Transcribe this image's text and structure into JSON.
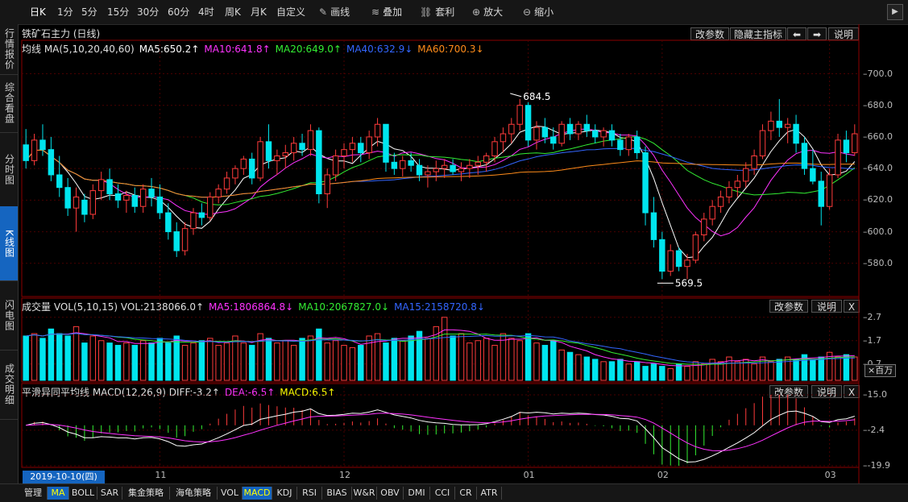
{
  "toolbar": {
    "periods": [
      "日K",
      "1分",
      "5分",
      "15分",
      "30分",
      "60分",
      "4时",
      "周K",
      "月K",
      "自定义"
    ],
    "active_period": "日K",
    "tools": [
      {
        "label": "画线",
        "icon": "pencil-icon"
      },
      {
        "label": "叠加",
        "icon": "stack-icon"
      },
      {
        "label": "套利",
        "icon": "link-icon"
      },
      {
        "label": "放大",
        "icon": "zoom-in-icon"
      },
      {
        "label": "缩小",
        "icon": "zoom-out-icon"
      }
    ]
  },
  "sidebar": {
    "tabs": [
      "行情报价",
      "综合看盘",
      "分时图",
      "K线图",
      "闪电图",
      "成交明细"
    ],
    "active": "K线图"
  },
  "main_chart": {
    "title": "铁矿石主力 (日线)",
    "buttons": {
      "params": "改参数",
      "hide": "隐藏主指标",
      "prev": "⬅",
      "next": "➡",
      "help": "说明"
    },
    "ma_legend": [
      {
        "text": "均线 MA(5,10,20,40,60)",
        "color": "#e0e0e0"
      },
      {
        "text": "MA5:650.2↑",
        "color": "#ffffff"
      },
      {
        "text": "MA10:641.8↑",
        "color": "#ff33ff"
      },
      {
        "text": "MA20:649.0↑",
        "color": "#33ee33"
      },
      {
        "text": "MA40:632.9↓",
        "color": "#3366ff"
      },
      {
        "text": "MA60:700.3↓",
        "color": "#ff8c1a"
      }
    ],
    "y_ticks": [
      "700.0",
      "680.0",
      "660.0",
      "640.0",
      "620.0",
      "600.0",
      "580.0"
    ],
    "annotations": {
      "high": "684.5",
      "low": "569.5"
    }
  },
  "vol_chart": {
    "legend": [
      {
        "text": "成交量 VOL(5,10,15) VOL:2138066.0↑",
        "color": "#e0e0e0"
      },
      {
        "text": "MA5:1806864.8↓",
        "color": "#ff33ff"
      },
      {
        "text": "MA10:2067827.0↓",
        "color": "#33ee33"
      },
      {
        "text": "MA15:2158720.8↓",
        "color": "#3366ff"
      }
    ],
    "buttons": {
      "params": "改参数",
      "help": "说明",
      "close": "X"
    },
    "y_ticks": [
      "2.7",
      "1.7",
      "0.7"
    ],
    "unit": "×百万"
  },
  "macd_chart": {
    "legend": [
      {
        "text": "平滑异同平均线 MACD(12,26,9) DIFF:-3.2↑",
        "color": "#e0e0e0"
      },
      {
        "text": "DEA:-6.5↑",
        "color": "#ff33ff"
      },
      {
        "text": "MACD:6.5↑",
        "color": "#ffff00"
      }
    ],
    "buttons": {
      "params": "改参数",
      "help": "说明",
      "close": "X"
    },
    "y_ticks": [
      "15.0",
      "-2.4",
      "-19.9"
    ]
  },
  "time_axis": {
    "selected_date": "2019-10-10(四)",
    "month_labels": [
      "11",
      "12",
      "01",
      "02",
      "03"
    ]
  },
  "bottom_tabs": [
    "管理",
    "MA",
    "BOLL",
    "SAR",
    "集金策略",
    "海龟策略",
    "VOL",
    "MACD",
    "KDJ",
    "RSI",
    "BIAS",
    "W&R",
    "OBV",
    "DMI",
    "CCI",
    "CR",
    "ATR"
  ],
  "bottom_active": [
    "MA",
    "MACD"
  ],
  "colors": {
    "up": "#ff3b3b",
    "down": "#00e5ee",
    "ma5": "#ffffff",
    "ma10": "#ff33ff",
    "ma20": "#33ee33",
    "ma40": "#3366ff",
    "ma60": "#ff8c1a"
  },
  "chart_data": {
    "type": "candlestick",
    "symbol": "铁矿石主力",
    "period": "日线",
    "ylim": [
      560,
      712
    ],
    "x": [
      "2019-10-10",
      "2019-10-11",
      "2019-10-14",
      "2019-10-15",
      "2019-10-16",
      "2019-10-17",
      "2019-10-18",
      "2019-10-21",
      "2019-10-22",
      "2019-10-23",
      "2019-10-24",
      "2019-10-25",
      "2019-10-28",
      "2019-10-29",
      "2019-10-30",
      "2019-10-31",
      "2019-11-01",
      "2019-11-04",
      "2019-11-05",
      "2019-11-06",
      "2019-11-07",
      "2019-11-08",
      "2019-11-11",
      "2019-11-12",
      "2019-11-13",
      "2019-11-14",
      "2019-11-15",
      "2019-11-18",
      "2019-11-19",
      "2019-11-20",
      "2019-11-21",
      "2019-11-22",
      "2019-11-25",
      "2019-11-26",
      "2019-11-27",
      "2019-11-28",
      "2019-11-29",
      "2019-12-02",
      "2019-12-03",
      "2019-12-04",
      "2019-12-05",
      "2019-12-06",
      "2019-12-09",
      "2019-12-10",
      "2019-12-11",
      "2019-12-12",
      "2019-12-13",
      "2019-12-16",
      "2019-12-17",
      "2019-12-18",
      "2019-12-19",
      "2019-12-20",
      "2019-12-23",
      "2019-12-24",
      "2019-12-25",
      "2019-12-26",
      "2019-12-27",
      "2019-12-30",
      "2019-12-31",
      "2020-01-02",
      "2020-01-03",
      "2020-01-06",
      "2020-01-07",
      "2020-01-08",
      "2020-01-09",
      "2020-01-10",
      "2020-01-13",
      "2020-01-14",
      "2020-01-15",
      "2020-01-16",
      "2020-01-17",
      "2020-01-20",
      "2020-01-21",
      "2020-01-22",
      "2020-01-23",
      "2020-02-03",
      "2020-02-04",
      "2020-02-05",
      "2020-02-06",
      "2020-02-07",
      "2020-02-10",
      "2020-02-11",
      "2020-02-12",
      "2020-02-13",
      "2020-02-14",
      "2020-02-17",
      "2020-02-18",
      "2020-02-19",
      "2020-02-20",
      "2020-02-21",
      "2020-02-24",
      "2020-02-25",
      "2020-02-26",
      "2020-02-27",
      "2020-02-28",
      "2020-03-02",
      "2020-03-03",
      "2020-03-04",
      "2020-03-05",
      "2020-03-06"
    ],
    "ohlc": [
      [
        655,
        665,
        640,
        645
      ],
      [
        645,
        662,
        642,
        658
      ],
      [
        658,
        668,
        648,
        652
      ],
      [
        652,
        660,
        632,
        636
      ],
      [
        636,
        648,
        622,
        628
      ],
      [
        628,
        634,
        610,
        615
      ],
      [
        615,
        628,
        600,
        622
      ],
      [
        620,
        624,
        606,
        611
      ],
      [
        611,
        630,
        608,
        626
      ],
      [
        626,
        638,
        620,
        633
      ],
      [
        633,
        640,
        620,
        624
      ],
      [
        624,
        630,
        615,
        620
      ],
      [
        620,
        626,
        612,
        623
      ],
      [
        623,
        628,
        612,
        616
      ],
      [
        616,
        630,
        612,
        627
      ],
      [
        627,
        634,
        616,
        622
      ],
      [
        622,
        630,
        608,
        612
      ],
      [
        612,
        618,
        595,
        600
      ],
      [
        600,
        606,
        584,
        588
      ],
      [
        588,
        606,
        585,
        602
      ],
      [
        602,
        615,
        598,
        612
      ],
      [
        612,
        618,
        604,
        609
      ],
      [
        609,
        625,
        607,
        622
      ],
      [
        622,
        630,
        618,
        627
      ],
      [
        627,
        638,
        624,
        634
      ],
      [
        634,
        642,
        630,
        640
      ],
      [
        640,
        648,
        636,
        646
      ],
      [
        646,
        650,
        630,
        634
      ],
      [
        634,
        660,
        632,
        657
      ],
      [
        657,
        668,
        640,
        645
      ],
      [
        645,
        652,
        636,
        648
      ],
      [
        648,
        655,
        640,
        650
      ],
      [
        650,
        660,
        645,
        656
      ],
      [
        656,
        662,
        648,
        652
      ],
      [
        652,
        668,
        648,
        664
      ],
      [
        664,
        666,
        618,
        624
      ],
      [
        624,
        640,
        615,
        636
      ],
      [
        636,
        652,
        632,
        648
      ],
      [
        648,
        656,
        640,
        652
      ],
      [
        652,
        660,
        644,
        656
      ],
      [
        656,
        660,
        644,
        650
      ],
      [
        650,
        664,
        646,
        660
      ],
      [
        660,
        672,
        654,
        668
      ],
      [
        668,
        668,
        638,
        644
      ],
      [
        644,
        650,
        636,
        640
      ],
      [
        640,
        648,
        635,
        645
      ],
      [
        645,
        650,
        638,
        642
      ],
      [
        642,
        646,
        632,
        636
      ],
      [
        636,
        642,
        628,
        638
      ],
      [
        638,
        645,
        632,
        640
      ],
      [
        640,
        646,
        634,
        642
      ],
      [
        642,
        646,
        636,
        638
      ],
      [
        638,
        644,
        632,
        640
      ],
      [
        640,
        646,
        634,
        642
      ],
      [
        642,
        648,
        636,
        644
      ],
      [
        644,
        650,
        638,
        648
      ],
      [
        648,
        660,
        644,
        657
      ],
      [
        657,
        666,
        650,
        662
      ],
      [
        662,
        672,
        656,
        668
      ],
      [
        668,
        684,
        664,
        680
      ],
      [
        680,
        682,
        654,
        658
      ],
      [
        658,
        670,
        652,
        666
      ],
      [
        666,
        672,
        656,
        660
      ],
      [
        660,
        666,
        652,
        656
      ],
      [
        656,
        670,
        654,
        668
      ],
      [
        668,
        672,
        658,
        662
      ],
      [
        662,
        670,
        658,
        668
      ],
      [
        668,
        674,
        660,
        664
      ],
      [
        664,
        668,
        656,
        660
      ],
      [
        660,
        666,
        654,
        664
      ],
      [
        664,
        668,
        654,
        658
      ],
      [
        658,
        662,
        648,
        652
      ],
      [
        652,
        662,
        648,
        660
      ],
      [
        660,
        664,
        646,
        650
      ],
      [
        650,
        654,
        604,
        612
      ],
      [
        612,
        622,
        590,
        595
      ],
      [
        595,
        600,
        570,
        575
      ],
      [
        575,
        592,
        572,
        588
      ],
      [
        588,
        590,
        575,
        578
      ],
      [
        578,
        586,
        570,
        582
      ],
      [
        582,
        600,
        580,
        598
      ],
      [
        598,
        612,
        594,
        608
      ],
      [
        608,
        620,
        604,
        616
      ],
      [
        616,
        626,
        612,
        622
      ],
      [
        622,
        632,
        618,
        628
      ],
      [
        628,
        636,
        622,
        632
      ],
      [
        632,
        644,
        628,
        640
      ],
      [
        640,
        652,
        636,
        648
      ],
      [
        648,
        668,
        646,
        664
      ],
      [
        664,
        676,
        658,
        670
      ],
      [
        670,
        684,
        660,
        666
      ],
      [
        666,
        672,
        656,
        668
      ],
      [
        668,
        674,
        650,
        656
      ],
      [
        656,
        660,
        636,
        640
      ],
      [
        640,
        652,
        630,
        632
      ],
      [
        632,
        638,
        604,
        616
      ],
      [
        616,
        640,
        614,
        636
      ],
      [
        636,
        662,
        634,
        658
      ],
      [
        658,
        664,
        644,
        650
      ],
      [
        650,
        668,
        648,
        662
      ]
    ],
    "volume_millions": [
      1.9,
      2.0,
      1.8,
      2.2,
      2.0,
      1.9,
      2.3,
      1.6,
      1.9,
      1.7,
      1.6,
      1.5,
      1.6,
      1.5,
      1.7,
      1.6,
      1.8,
      1.6,
      1.9,
      1.5,
      1.6,
      1.7,
      1.8,
      1.5,
      1.6,
      1.9,
      1.6,
      1.5,
      2.0,
      1.8,
      1.6,
      1.7,
      1.5,
      1.8,
      1.9,
      2.2,
      1.6,
      1.7,
      1.5,
      1.4,
      1.5,
      1.9,
      2.0,
      1.6,
      1.8,
      1.7,
      1.9,
      2.1,
      1.8,
      2.3,
      2.7,
      1.9,
      2.0,
      1.6,
      1.7,
      1.8,
      1.5,
      2.0,
      1.8,
      1.7,
      2.0,
      1.6,
      1.5,
      1.7,
      1.3,
      1.2,
      1.1,
      1.0,
      0.9,
      0.8,
      0.8,
      0.9,
      0.7,
      0.8,
      0.6,
      0.7,
      0.6,
      0.5,
      0.7,
      0.6,
      0.8,
      0.7,
      0.9,
      0.8,
      1.0,
      0.8,
      0.9,
      0.7,
      1.0,
      0.8,
      0.9,
      1.0,
      0.9,
      1.1,
      0.9,
      1.0,
      1.2,
      1.0,
      1.1,
      1.0
    ],
    "high_label": {
      "index": 59,
      "value": 684.5
    },
    "low_label": {
      "index": 76,
      "value": 569.5
    }
  }
}
